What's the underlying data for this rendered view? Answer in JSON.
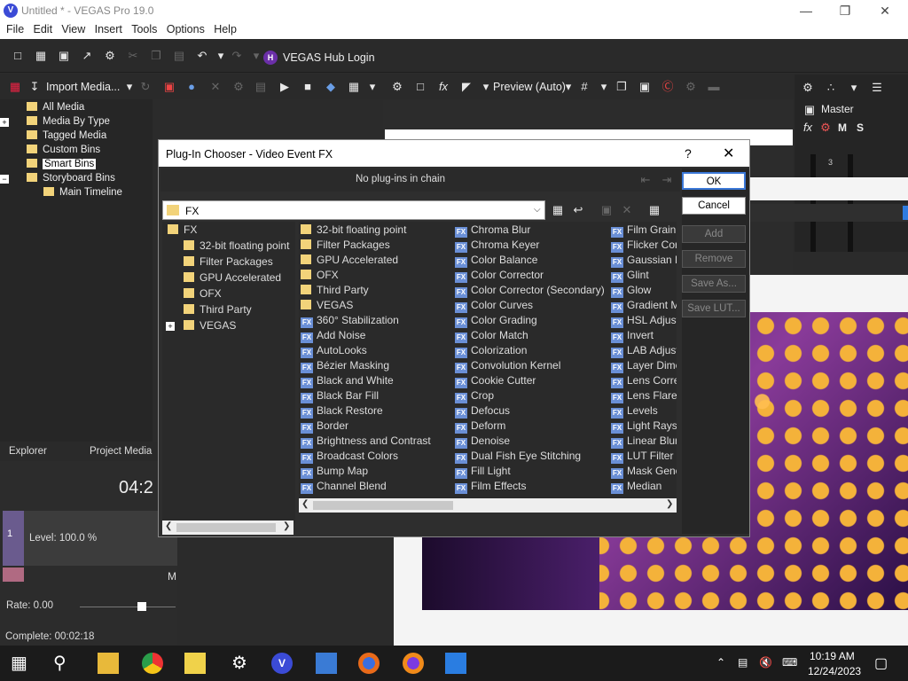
{
  "window": {
    "title": "Untitled * - VEGAS Pro 19.0",
    "logo_letter": "V"
  },
  "menu": [
    "File",
    "Edit",
    "View",
    "Insert",
    "Tools",
    "Options",
    "Help"
  ],
  "toolbar": {
    "hub_logo_letter": "H",
    "hub_login": "VEGAS Hub Login",
    "import_media": "Import Media...",
    "preview_quality": "Preview (Auto)"
  },
  "explorer": {
    "items": [
      {
        "label": "All Media"
      },
      {
        "label": "Media By Type",
        "expand": "+"
      },
      {
        "label": "Tagged Media"
      },
      {
        "label": "Custom Bins"
      },
      {
        "label": "Smart Bins",
        "selected": true
      },
      {
        "label": "Storyboard Bins",
        "expand": "−"
      },
      {
        "label": "Main Timeline"
      }
    ],
    "tabs": [
      "Explorer",
      "Project Media"
    ]
  },
  "timeline": {
    "timecode": "04:2",
    "level": "Level: 100.0 %",
    "rate": "Rate: 0.00",
    "complete": "Complete: 00:02:18",
    "track_number": "1",
    "m_label": "M"
  },
  "mixer": {
    "master_label": "Master",
    "m": "M",
    "s": "S",
    "meter_value": "3"
  },
  "dialog": {
    "title": "Plug-In Chooser - Video Event FX",
    "help": "?",
    "close": "✕",
    "chain_text": "No plug-ins in chain",
    "path": "FX",
    "left_tree": [
      {
        "label": "FX"
      },
      {
        "label": "32-bit floating point"
      },
      {
        "label": "Filter Packages"
      },
      {
        "label": "GPU Accelerated"
      },
      {
        "label": "OFX"
      },
      {
        "label": "Third Party"
      },
      {
        "label": "VEGAS",
        "expand": "+"
      }
    ],
    "column1": [
      {
        "label": "32-bit floating point",
        "kind": "folder"
      },
      {
        "label": "Filter Packages",
        "kind": "folder"
      },
      {
        "label": "GPU Accelerated",
        "kind": "folder"
      },
      {
        "label": "OFX",
        "kind": "folder"
      },
      {
        "label": "Third Party",
        "kind": "folder"
      },
      {
        "label": "VEGAS",
        "kind": "folder"
      },
      {
        "label": "360° Stabilization",
        "kind": "fx"
      },
      {
        "label": "Add Noise",
        "kind": "fx"
      },
      {
        "label": "AutoLooks",
        "kind": "fx"
      },
      {
        "label": "Bézier Masking",
        "kind": "fx"
      },
      {
        "label": "Black and White",
        "kind": "fx"
      },
      {
        "label": "Black Bar Fill",
        "kind": "fx"
      },
      {
        "label": "Black Restore",
        "kind": "fx"
      },
      {
        "label": "Border",
        "kind": "fx"
      },
      {
        "label": "Brightness and Contrast",
        "kind": "fx"
      },
      {
        "label": "Broadcast Colors",
        "kind": "fx"
      },
      {
        "label": "Bump Map",
        "kind": "fx"
      },
      {
        "label": "Channel Blend",
        "kind": "fx"
      }
    ],
    "column2": [
      "Chroma Blur",
      "Chroma Keyer",
      "Color Balance",
      "Color Corrector",
      "Color Corrector (Secondary)",
      "Color Curves",
      "Color Grading",
      "Color Match",
      "Colorization",
      "Convolution Kernel",
      "Cookie Cutter",
      "Crop",
      "Defocus",
      "Deform",
      "Denoise",
      "Dual Fish Eye Stitching",
      "Fill Light",
      "Film Effects"
    ],
    "column3": [
      "Film Grain",
      "Flicker Cor",
      "Gaussian B",
      "Glint",
      "Glow",
      "Gradient M",
      "HSL Adjust",
      "Invert",
      "LAB Adjust",
      "Layer Dime",
      "Lens Corre",
      "Lens Flare",
      "Levels",
      "Light Rays",
      "Linear Blur",
      "LUT Filter",
      "Mask Gene",
      "Median"
    ],
    "fx_badge": "FX",
    "buttons": {
      "ok": "OK",
      "cancel": "Cancel",
      "add": "Add",
      "remove": "Remove",
      "save_as": "Save As...",
      "save_lut": "Save LUT..."
    }
  },
  "taskbar": {
    "time": "10:19 AM",
    "date": "12/24/2023"
  }
}
